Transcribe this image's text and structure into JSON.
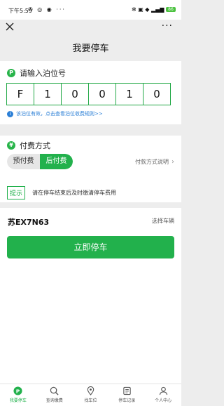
{
  "status_bar": {
    "time": "下午5:59",
    "icons_left": "✇ ◎ ◉ ···",
    "icons_right": "✻ ▣ ◆ ▂▄▆",
    "battery": "86"
  },
  "nav": {
    "title": "我要停车",
    "more": "···"
  },
  "berth": {
    "heading": "请输入泊位号",
    "chars": [
      "F",
      "1",
      "0",
      "0",
      "1",
      "0"
    ],
    "notice": "该泊位有效，点击查看泊位收费规则>>"
  },
  "payment": {
    "heading": "付费方式",
    "options": [
      "预付费",
      "后付费"
    ],
    "selected": "后付费",
    "description": "付款方式说明",
    "tip_badge": "提示",
    "tip_text": "请在停车结束后及时缴清停车费用"
  },
  "vehicle": {
    "plate": "苏EX7N63",
    "select_label": "选择车辆"
  },
  "action": {
    "park_now": "立即停车"
  },
  "tabs": [
    {
      "label": "我要停车",
      "icon": "parking-icon",
      "active": true
    },
    {
      "label": "查询缴费",
      "icon": "search-icon",
      "active": false
    },
    {
      "label": "找车位",
      "icon": "location-pin-icon",
      "active": false
    },
    {
      "label": "停车记录",
      "icon": "document-icon",
      "active": false
    },
    {
      "label": "个人中心",
      "icon": "person-icon",
      "active": false
    }
  ],
  "colors": {
    "accent": "#22b14c",
    "info": "#2b7fd6",
    "background": "#ededed"
  }
}
